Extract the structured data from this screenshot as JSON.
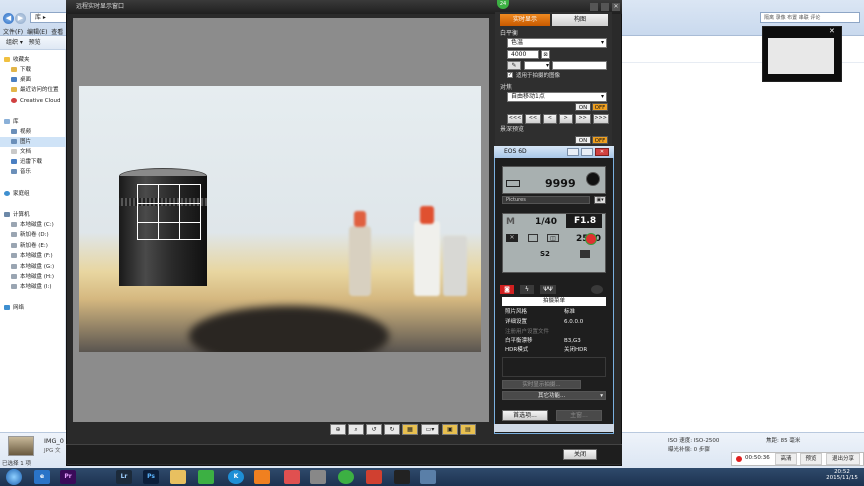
{
  "explorer": {
    "address": "库 ▸",
    "search_placeholder": "搜索 图片",
    "menu": [
      "文件(F)",
      "编辑(E)",
      "查看"
    ],
    "toolbar": [
      "组织 ▾",
      "预览"
    ],
    "favorites_title": "收藏夹",
    "favorites": [
      "下载",
      "桌面",
      "最近访问的位置",
      "Creative Cloud"
    ],
    "libraries_title": "库",
    "libraries": [
      "视频",
      "图片",
      "文档",
      "迅雷下载",
      "音乐"
    ],
    "homegroup": "家庭组",
    "computer_title": "计算机",
    "drives": [
      "本地磁盘 (C:)",
      "新加卷 (D:)",
      "新加卷 (E:)",
      "本地磁盘 (F:)",
      "本地磁盘 (G:)",
      "本地磁盘 (H:)",
      "本地磁盘 (I:)"
    ],
    "network": "网络",
    "status_left": "已选择 1 项",
    "file_name": "IMG_0",
    "file_type": "JPG 文",
    "top_right_text": "隔离 录像 布置 串联 评论"
  },
  "status_details": {
    "iso": "ISO 速度: ISO-2500",
    "focal": "焦距: 85 毫米",
    "flash": "曝光补偿: 0 步骤"
  },
  "recorder": {
    "time": "00:50:36",
    "btn1": "高清",
    "btn2": "预览",
    "btn3": "退出分享"
  },
  "clock": {
    "time": "20:52",
    "date": "2015/11/15"
  },
  "liveview": {
    "title": "远程实时显示窗口",
    "close_label": "关闭",
    "toolbar_icons": [
      "target-icon",
      "zoom-icon",
      "rotate-left-icon",
      "rotate-right-icon",
      "grid-icon",
      "aspect-icon",
      "lock-icon",
      "save-icon"
    ]
  },
  "settings": {
    "badge": "24",
    "tab_live": "实时显示",
    "tab_compose": "构图",
    "wb_label": "白平衡",
    "wb_value": "色温",
    "kelvin": "4000",
    "wb_apply": "适用于拍摄的图像",
    "focus_label": "对焦",
    "focus_mode": "自由移动1点",
    "on": "ON",
    "off": "OFF",
    "focus_buttons": [
      "<<<",
      "<<",
      "<",
      ">",
      ">>",
      ">>>"
    ],
    "dof_label": "景深预览"
  },
  "eos": {
    "title": "EOS 6D",
    "shots": "9999",
    "style": "Pictures",
    "shutter": "1/40",
    "aperture": "F1.8",
    "iso": "2500",
    "s2": "S2",
    "menu_title": "拍摄菜单",
    "rows": [
      {
        "k": "照片风格",
        "v": "标准"
      },
      {
        "k": "详细设置",
        "v": "6.0.0.0"
      },
      {
        "k": "注册用户设置文件",
        "v": ""
      },
      {
        "k": "白平衡漂移",
        "v": "B3,G3"
      },
      {
        "k": "HDR模式",
        "v": "关闭HDR"
      }
    ],
    "btn_live": "实时显示拍摄...",
    "btn_func": "其它功能...",
    "btn_prefs": "首选项...",
    "btn_main": "主窗..."
  }
}
